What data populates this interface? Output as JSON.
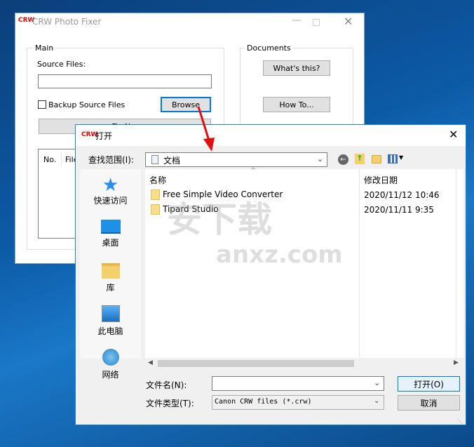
{
  "main_window": {
    "title": "CRW Photo Fixer",
    "logo_text": "CRW",
    "main_group": "Main",
    "source_files_label": "Source Files:",
    "source_files_value": "",
    "backup_checkbox_label": "Backup Source Files",
    "backup_checked": false,
    "browse_label": "Browse",
    "fix_label": "Fix N...",
    "columns": [
      "No.",
      "File"
    ],
    "documents_group": "Documents",
    "whats_this_label": "What's this?",
    "how_to_label": "How To..."
  },
  "dialog": {
    "title": "打开",
    "look_in_label": "查找范围(I):",
    "look_in_value": "文档",
    "toolbar_icons": [
      "back-icon",
      "up-folder-icon",
      "new-folder-icon",
      "view-menu-icon"
    ],
    "places": [
      {
        "label": "快速访问",
        "icon": "star-icon"
      },
      {
        "label": "桌面",
        "icon": "desktop-icon"
      },
      {
        "label": "库",
        "icon": "library-icon"
      },
      {
        "label": "此电脑",
        "icon": "computer-icon"
      },
      {
        "label": "网络",
        "icon": "network-icon"
      }
    ],
    "columns": [
      "名称",
      "修改日期"
    ],
    "files": [
      {
        "name": "Free Simple Video Converter",
        "modified": "2020/11/12 10:46"
      },
      {
        "name": "Tipard Studio",
        "modified": "2020/11/11 9:35"
      }
    ],
    "file_name_label": "文件名(N):",
    "file_name_value": "",
    "file_type_label": "文件类型(T):",
    "file_type_value": "Canon CRW files (*.crw)",
    "open_label": "打开(O)",
    "cancel_label": "取消"
  },
  "watermark": {
    "text": "安下载",
    "sub": "anxz.com"
  },
  "colors": {
    "accent": "#0078d7",
    "arrow": "#e01010"
  }
}
